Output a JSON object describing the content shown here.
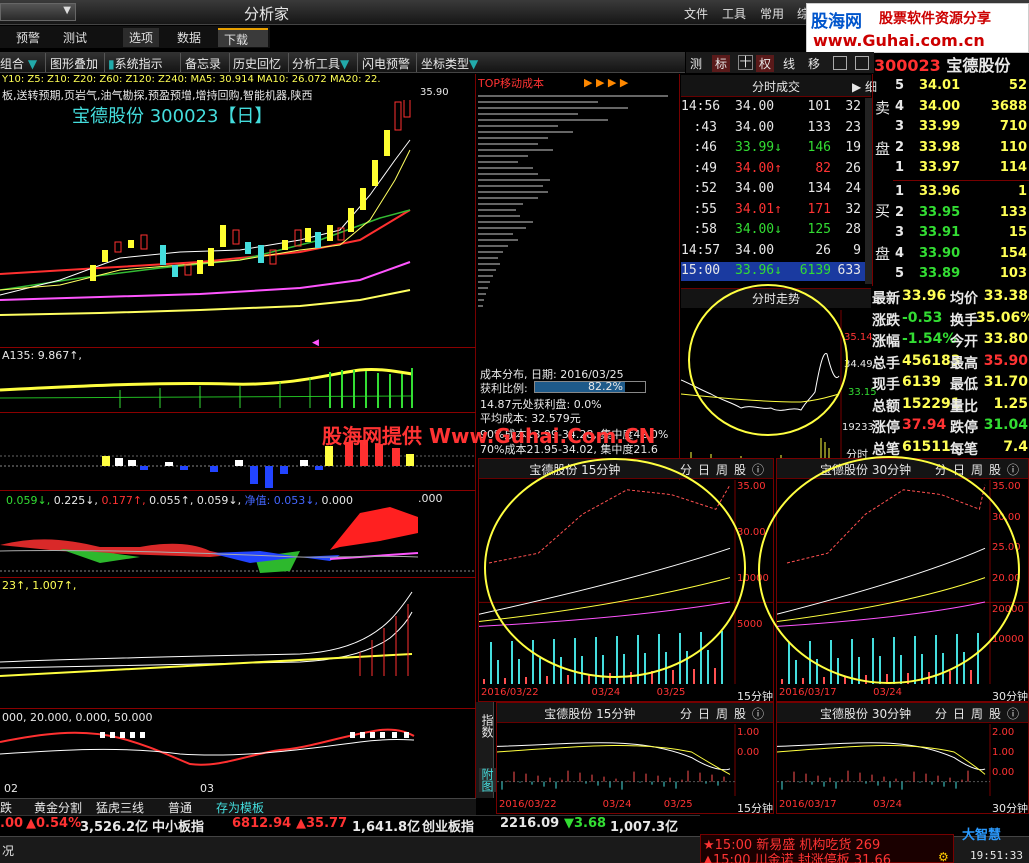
{
  "app": {
    "title": "分析家",
    "combo_arrow": "▼"
  },
  "menu": [
    "文件",
    "工具",
    "常用",
    "综"
  ],
  "logo": {
    "l1": "股海网",
    "l2": "股票软件资源分享",
    "l3": "www.Guhai.com.cn"
  },
  "tabs": [
    "预警",
    "测试",
    "选项",
    "数据",
    "下载"
  ],
  "toolbar": [
    "组合",
    "图形叠加",
    "系统指示",
    "备忘录",
    "历史回忆",
    "分析工具",
    "闪电预警",
    "坐标类型"
  ],
  "right_tools": [
    "测",
    "标",
    "十",
    "权",
    "线",
    "移"
  ],
  "stock": {
    "code": "300023",
    "name": "宝德股份",
    "chart_title": "宝德股份  300023【日】"
  },
  "main_chart": {
    "ma_line": "Y10:  Z5:  Z10:  Z20:  Z60:  Z120:  Z240:  MA5: 30.914  MA10: 26.072  MA20: 22.",
    "concept": "板,送转预期,页岩气,油气勘探,预盈预增,增持回购,智能机器,陕西",
    "high_label": "35.90",
    "ind1": "A135: 9.867↑,",
    "ind3": [
      "0.059↓,",
      "0.225↓,",
      "0.177↑,",
      "0.055↑,",
      "0.059↓,",
      "净值: 0.053↓,",
      "0.000",
      ".000"
    ],
    "ind4": "23↑,  1.007↑,",
    "ind5": "000,  20.000,  0.000,  50.000",
    "x_labels": [
      "02",
      "03"
    ]
  },
  "cost_panel": {
    "header": "TOP移动成本",
    "date": "成本分布, 日期: 2016/03/25",
    "profit_label": "获利比例:",
    "profit_value": "82.2%",
    "line3": "14.87元处获利盘: 0.0%",
    "line4": "平均成本: 32.579元",
    "line5": "90%成本13.99-34.28, 集中度42.0%",
    "line6": "70%成本21.95-34.02, 集中度21.6"
  },
  "watermark": "股海网提供 Www.Guhai.Com.CN",
  "ticks": {
    "header": "分时成交",
    "detail": "细",
    "rows": [
      {
        "t": "14:56",
        "p": "34.00",
        "a": "",
        "v": "101",
        "n": "32",
        "c": "white"
      },
      {
        "t": ":43",
        "p": "34.00",
        "a": "",
        "v": "133",
        "n": "23",
        "c": "white"
      },
      {
        "t": ":46",
        "p": "33.99",
        "a": "↓",
        "v": "146",
        "n": "19",
        "c": "green"
      },
      {
        "t": ":49",
        "p": "34.00",
        "a": "↑",
        "v": "82",
        "n": "26",
        "c": "red"
      },
      {
        "t": ":52",
        "p": "34.00",
        "a": "",
        "v": "134",
        "n": "24",
        "c": "white"
      },
      {
        "t": ":55",
        "p": "34.01",
        "a": "↑",
        "v": "171",
        "n": "32",
        "c": "red"
      },
      {
        "t": ":58",
        "p": "34.00",
        "a": "↓",
        "v": "125",
        "n": "28",
        "c": "green"
      },
      {
        "t": "14:57",
        "p": "34.00",
        "a": "",
        "v": "26",
        "n": "9",
        "c": "white"
      },
      {
        "t": "15:00",
        "p": "33.96",
        "a": "↓",
        "v": "6139",
        "n": "633",
        "c": "green"
      }
    ]
  },
  "orderbook": {
    "sell_label": [
      "卖",
      "盘"
    ],
    "buy_label": [
      "买",
      "盘"
    ],
    "sell": [
      {
        "l": "5",
        "p": "34.01",
        "v": "52"
      },
      {
        "l": "4",
        "p": "34.00",
        "v": "3688"
      },
      {
        "l": "3",
        "p": "33.99",
        "v": "710"
      },
      {
        "l": "2",
        "p": "33.98",
        "v": "110"
      },
      {
        "l": "1",
        "p": "33.97",
        "v": "114"
      }
    ],
    "buy": [
      {
        "l": "1",
        "p": "33.96",
        "v": "1"
      },
      {
        "l": "2",
        "p": "33.95",
        "v": "133"
      },
      {
        "l": "3",
        "p": "33.91",
        "v": "15"
      },
      {
        "l": "4",
        "p": "33.90",
        "v": "154"
      },
      {
        "l": "5",
        "p": "33.89",
        "v": "103"
      }
    ]
  },
  "stats": [
    {
      "k1": "最新",
      "v1": "33.96",
      "k2": "均价",
      "v2": "33.38"
    },
    {
      "k1": "涨跌",
      "v1": "-0.53",
      "k2": "换手",
      "v2": "35.06%"
    },
    {
      "k1": "涨幅",
      "v1": "-1.54%",
      "k2": "今开",
      "v2": "33.80"
    },
    {
      "k1": "总手",
      "v1": "456183",
      "k2": "最高",
      "v2": "35.90"
    },
    {
      "k1": "现手",
      "v1": "6139",
      "k2": "最低",
      "v2": "31.70"
    },
    {
      "k1": "总额",
      "v1": "152291",
      "k2": "量比",
      "v2": "1.25"
    },
    {
      "k1": "涨停",
      "v1": "37.94",
      "k2": "跌停",
      "v2": "31.04"
    },
    {
      "k1": "总笔",
      "v1": "61511",
      "k2": "每笔",
      "v2": "7.4"
    }
  ],
  "intraday": {
    "header": "分时走势",
    "p1": "35.14",
    "p2": "34.49",
    "p3": "33.15",
    "vol": "19233",
    "unit": "分时"
  },
  "mini": [
    {
      "title": "宝德股份 15分钟",
      "d1": "2016/03/22",
      "d2": "03/24",
      "d3": "03/25",
      "unit": "15分钟",
      "y": [
        "35.00",
        "30.00",
        "10000",
        "5000"
      ]
    },
    {
      "title": "宝德股份 30分钟",
      "d1": "2016/03/17",
      "d2": "03/24",
      "d3": "",
      "unit": "30分钟",
      "y": [
        "35.00",
        "30.00",
        "25.00",
        "20.00",
        "20000",
        "10000"
      ]
    },
    {
      "title": "宝德股份 15分钟",
      "d1": "2016/03/22",
      "d2": "03/24",
      "d3": "03/25",
      "unit": "15分钟",
      "y": [
        "1.00",
        "0.00"
      ]
    },
    {
      "title": "宝德股份 30分钟",
      "d1": "2016/03/17",
      "d2": "03/24",
      "d3": "",
      "unit": "30分钟",
      "y": [
        "2.00",
        "1.00",
        "0.00"
      ]
    }
  ],
  "mini_tabs": [
    "分",
    "日",
    "周",
    "股",
    "ⓘ"
  ],
  "side_tabs": [
    "指数",
    "附图"
  ],
  "bottom_tabs": [
    "跌",
    "黄金分割",
    "猛虎三线",
    "普通",
    "存为模板"
  ],
  "ticker": [
    {
      "t": ".00",
      "c": "red"
    },
    {
      "t": "▲0.54%",
      "c": "red"
    },
    {
      "t": "3,526.2亿",
      "c": "white"
    },
    {
      "t": "中小板指",
      "c": "white"
    },
    {
      "t": "6812.94",
      "c": "red"
    },
    {
      "t": "▲35.77",
      "c": "red"
    },
    {
      "t": "1,641.8亿",
      "c": "white"
    },
    {
      "t": "创业板指",
      "c": "white"
    },
    {
      "t": "2216.09",
      "c": "white"
    },
    {
      "t": "▼3.68",
      "c": "green"
    },
    {
      "t": "1,007.3亿",
      "c": "white"
    }
  ],
  "status": {
    "news1": "★15:00 新易盛  机构吃货 269",
    "news2": "▲15:00 川金诺  封涨停板 31.66",
    "brand": "大智慧",
    "time": "19:51:33",
    "left": "况"
  }
}
